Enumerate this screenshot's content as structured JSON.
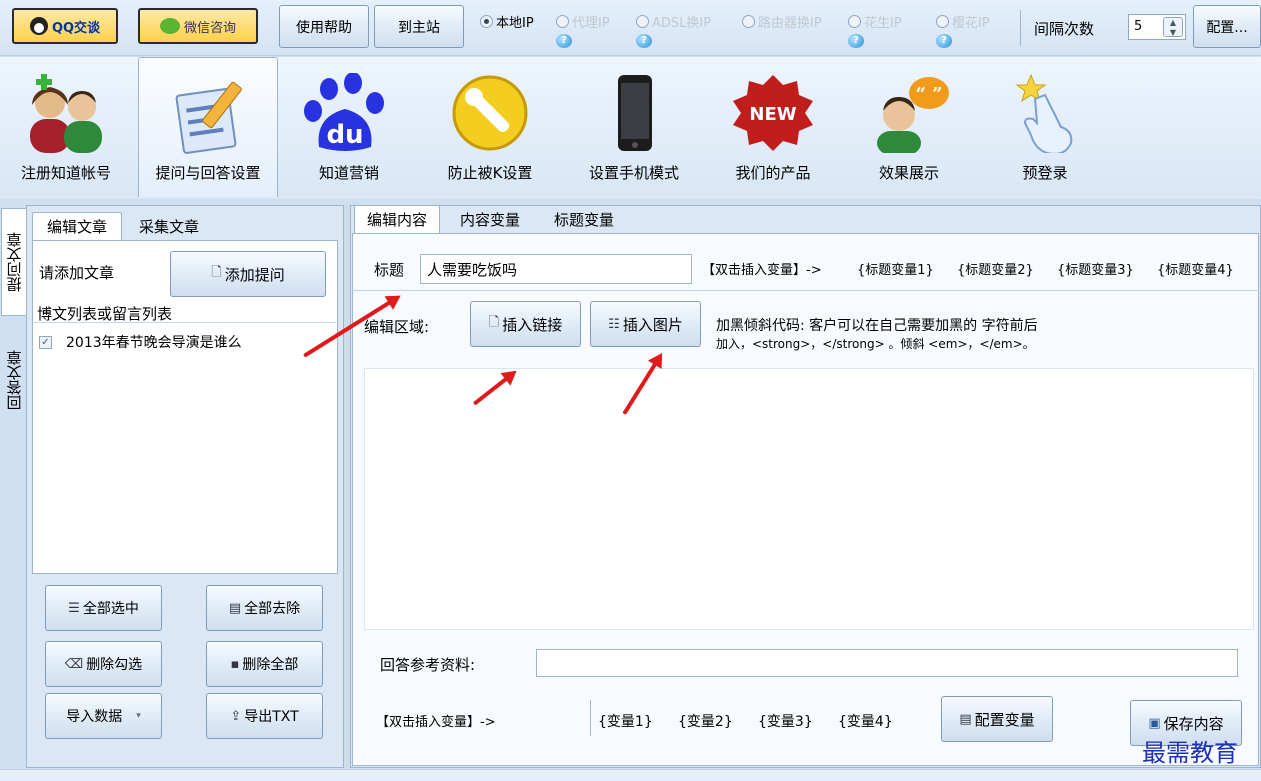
{
  "topbar": {
    "qq_button": "QQ交谈",
    "wechat_button": "微信咨询",
    "help_button": "使用帮助",
    "home_button": "到主站",
    "ip_modes": [
      {
        "label": "本地IP",
        "selected": true
      },
      {
        "label": "代理IP",
        "selected": false
      },
      {
        "label": "ADSL换IP",
        "selected": false
      },
      {
        "label": "路由器换IP",
        "selected": false
      },
      {
        "label": "花生IP",
        "selected": false
      },
      {
        "label": "樱花IP",
        "selected": false
      }
    ],
    "interval_label": "间隔次数",
    "interval_value": "5",
    "config_button": "配置..."
  },
  "toolbar": {
    "items": [
      {
        "label": "注册知道帐号",
        "icon": "users-icon"
      },
      {
        "label": "提问与回答设置",
        "icon": "edit-document-icon"
      },
      {
        "label": "知道营销",
        "icon": "baidu-paw-icon"
      },
      {
        "label": "防止被K设置",
        "icon": "wrench-icon"
      },
      {
        "label": "设置手机模式",
        "icon": "phone-icon"
      },
      {
        "label": "我们的产品",
        "icon": "new-badge-icon"
      },
      {
        "label": "效果展示",
        "icon": "speech-user-icon"
      },
      {
        "label": "预登录",
        "icon": "pointing-hand-icon"
      }
    ]
  },
  "side_tabs": [
    "提问文章",
    "回答文章"
  ],
  "left": {
    "tabs": [
      "编辑文章",
      "采集文章"
    ],
    "add_label": "请添加文章",
    "add_button": "添加提问",
    "list_title": "博文列表或留言列表",
    "list_items": [
      {
        "label": "2013年春节晚会导演是谁么",
        "checked": true
      }
    ],
    "select_all": "全部选中",
    "remove_all": "全部去除",
    "delete_checked": "删除勾选",
    "delete_all": "删除全部",
    "import_data": "导入数据",
    "export_txt": "导出TXT"
  },
  "right": {
    "tabs": [
      "编辑内容",
      "内容变量",
      "标题变量"
    ],
    "title_label": "标题",
    "title_value": "人需要吃饭吗",
    "title_insert_hint": "【双击插入变量】->",
    "title_vars": [
      "{标题变量1}",
      "{标题变量2}",
      "{标题变量3}",
      "{标题变量4}"
    ],
    "edit_label": "编辑区域:",
    "insert_link": "插入链接",
    "insert_image": "插入图片",
    "bold_hint_1": "加黑倾斜代码: 客户可以在自己需要加黑的 字符前后",
    "bold_hint_2": "加入，<strong>，</strong> 。倾斜 <em>，</em>。",
    "ref_label": "回答参考资料:",
    "ref_value": "",
    "var_insert_hint": "【双击插入变量】->",
    "vars": [
      "{变量1}",
      "{变量2}",
      "{变量3}",
      "{变量4}"
    ],
    "config_vars": "配置变量",
    "save_content": "保存内容"
  },
  "watermark": "最需教育",
  "colors": {
    "accent_red": "#e01a1a",
    "panel_border": "#9fb5cf",
    "background": "#cfe0f3"
  }
}
